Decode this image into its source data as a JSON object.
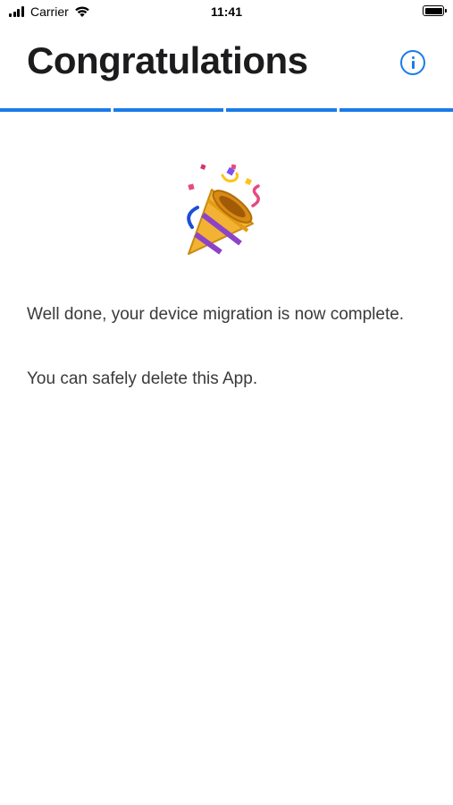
{
  "status_bar": {
    "carrier": "Carrier",
    "time": "11:41"
  },
  "header": {
    "title": "Congratulations",
    "info_icon": "info-circle-icon",
    "accent_color": "#1a7bea"
  },
  "progress": {
    "total_steps": 4,
    "completed_steps": 4
  },
  "content": {
    "icon": "party-popper-icon",
    "message": "Well done, your device migration is now complete.",
    "instruction": "You can safely delete this App."
  }
}
